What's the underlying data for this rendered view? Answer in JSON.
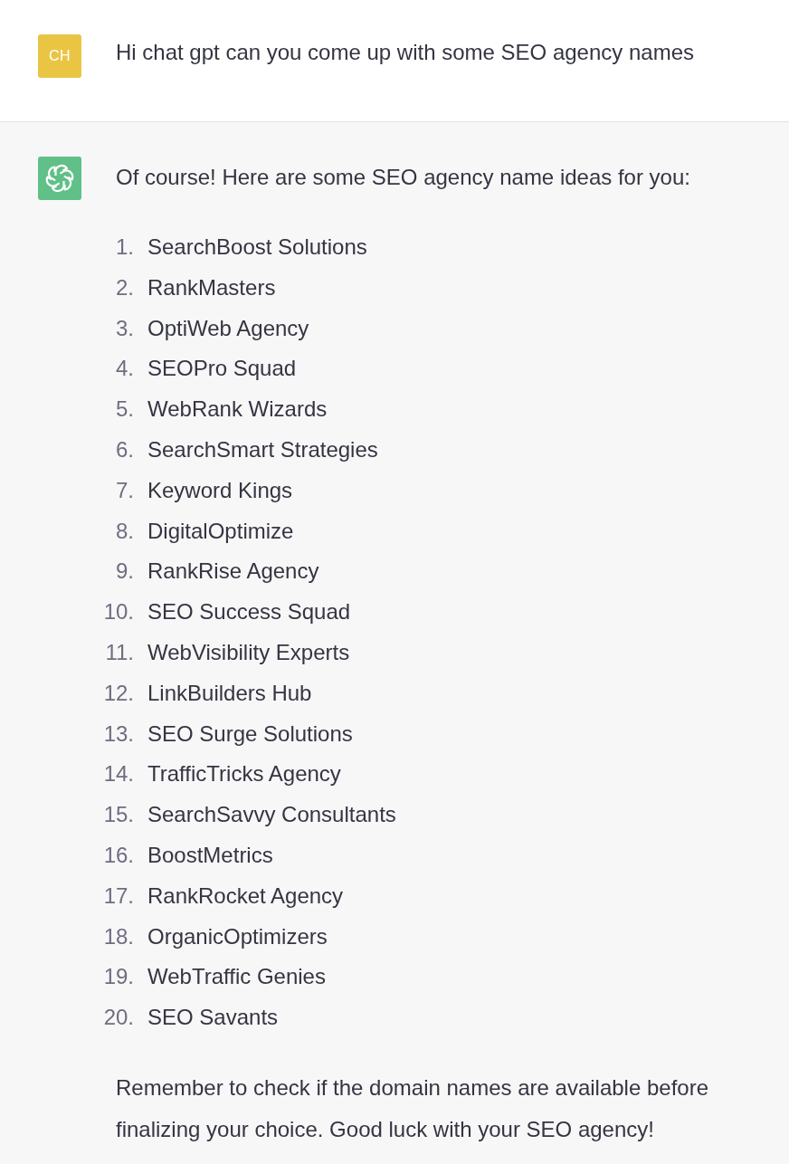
{
  "conversation": [
    {
      "kind": "user",
      "avatar_initials": "CH",
      "text": "Hi chat gpt can you come up with some SEO agency names"
    },
    {
      "kind": "assistant",
      "blocks": [
        {
          "kind": "paragraph",
          "text": "Of course! Here are some SEO agency name ideas for you:"
        },
        {
          "kind": "ordered_list",
          "items": [
            {
              "number": "1.",
              "text": "SearchBoost Solutions"
            },
            {
              "number": "2.",
              "text": "RankMasters"
            },
            {
              "number": "3.",
              "text": "OptiWeb Agency"
            },
            {
              "number": "4.",
              "text": "SEOPro Squad"
            },
            {
              "number": "5.",
              "text": "WebRank Wizards"
            },
            {
              "number": "6.",
              "text": "SearchSmart Strategies"
            },
            {
              "number": "7.",
              "text": "Keyword Kings"
            },
            {
              "number": "8.",
              "text": "DigitalOptimize"
            },
            {
              "number": "9.",
              "text": "RankRise Agency"
            },
            {
              "number": "10.",
              "text": "SEO Success Squad"
            },
            {
              "number": "11.",
              "text": "WebVisibility Experts"
            },
            {
              "number": "12.",
              "text": "LinkBuilders Hub"
            },
            {
              "number": "13.",
              "text": "SEO Surge Solutions"
            },
            {
              "number": "14.",
              "text": "TrafficTricks Agency"
            },
            {
              "number": "15.",
              "text": "SearchSavvy Consultants"
            },
            {
              "number": "16.",
              "text": "BoostMetrics"
            },
            {
              "number": "17.",
              "text": "RankRocket Agency"
            },
            {
              "number": "18.",
              "text": "OrganicOptimizers"
            },
            {
              "number": "19.",
              "text": "WebTraffic Genies"
            },
            {
              "number": "20.",
              "text": "SEO Savants"
            }
          ]
        },
        {
          "kind": "paragraph",
          "text": "Remember to check if the domain names are available before finalizing your choice. Good luck with your SEO agency!"
        }
      ]
    }
  ]
}
